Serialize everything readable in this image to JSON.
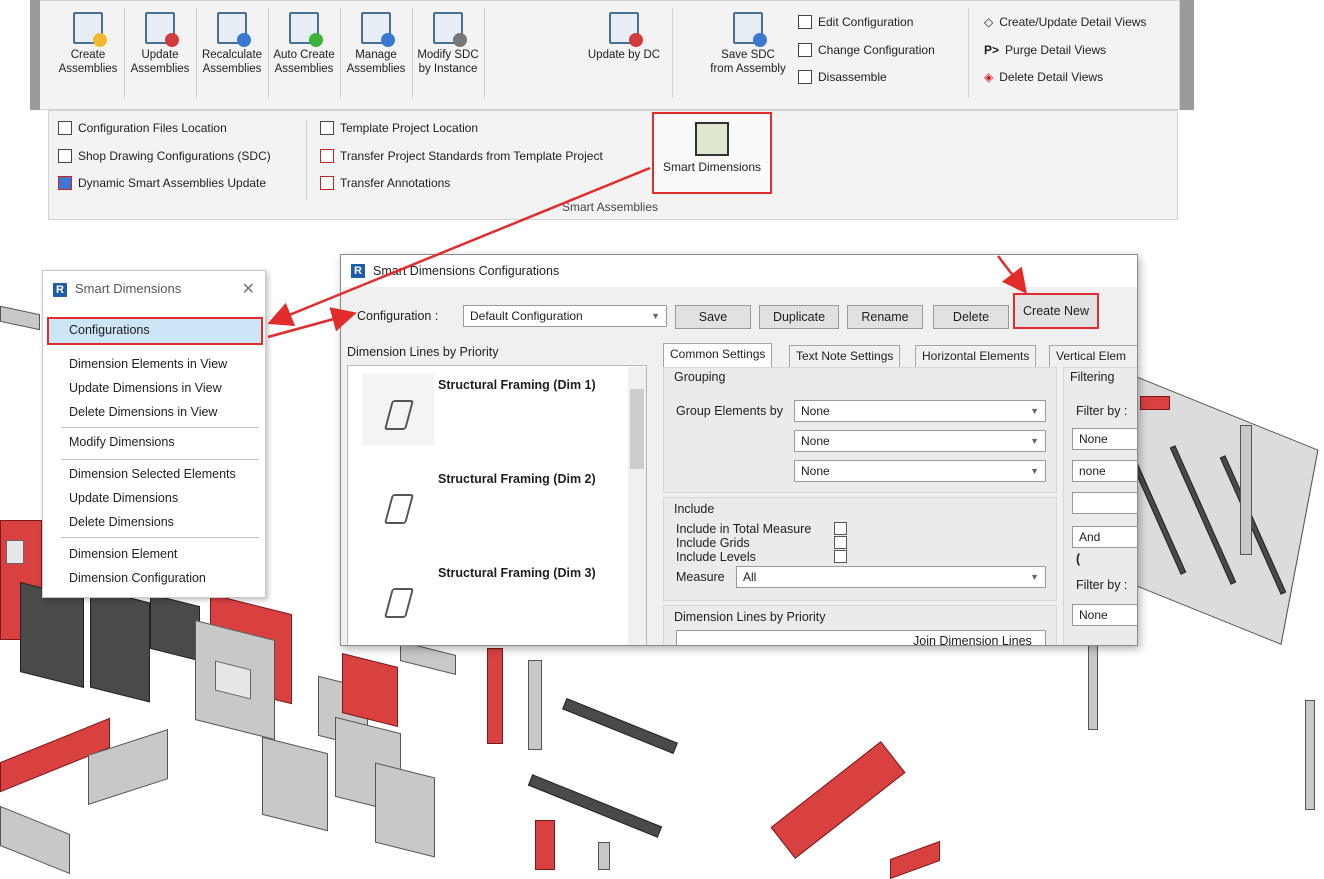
{
  "ribbon": {
    "large_buttons": [
      {
        "label1": "Create",
        "label2": "Assemblies",
        "badge": "#f1b92e"
      },
      {
        "label1": "Update",
        "label2": "Assemblies",
        "badge": "#d23c3c"
      },
      {
        "label1": "Recalculate",
        "label2": "Assemblies",
        "badge": "#3c78d2"
      },
      {
        "label1": "Auto Create",
        "label2": "Assemblies",
        "badge": "#3cb43c"
      },
      {
        "label1": "Manage",
        "label2": "Assemblies",
        "badge": "#3c78d2"
      },
      {
        "label1": "Modify SDC",
        "label2": "by Instance",
        "badge": "#777777"
      },
      {
        "label1": "Update by DC",
        "label2": "",
        "badge": "#d23c3c"
      },
      {
        "label1": "Save SDC",
        "label2": "from Assembly",
        "badge": "#3c78d2"
      }
    ],
    "config_items": [
      "Edit Configuration",
      "Change Configuration",
      "Disassemble"
    ],
    "detail_items": [
      "Create/Update Detail Views",
      "Purge Detail Views",
      "Delete Detail Views"
    ],
    "row2_left": [
      "Configuration Files Location",
      "Shop Drawing Configurations (SDC)",
      "Dynamic Smart Assemblies Update"
    ],
    "row2_mid": [
      "Template Project Location",
      "Transfer Project Standards from Template Project",
      "Transfer Annotations"
    ],
    "smart_dimensions_label": "Smart Dimensions",
    "panel_title": "Smart Assemblies"
  },
  "menu": {
    "logo": "R",
    "title": "Smart Dimensions",
    "close": "✕",
    "items": [
      "Configurations",
      "Dimension Elements in View",
      "Update Dimensions in View",
      "Delete Dimensions in View",
      "Modify Dimensions",
      "Dimension Selected Elements",
      "Update Dimensions",
      "Delete Dimensions",
      "Dimension Element",
      "Dimension Configuration"
    ]
  },
  "dialog": {
    "logo": "R",
    "title": "Smart Dimensions Configurations",
    "config_label": "Configuration :",
    "config_value": "Default Configuration",
    "buttons": [
      "Save",
      "Duplicate",
      "Rename",
      "Delete",
      "Create New"
    ],
    "list_title": "Dimension Lines by Priority",
    "list_items": [
      "Structural Framing (Dim 1)",
      "Structural Framing (Dim 2)",
      "Structural Framing (Dim 3)"
    ],
    "tabs": [
      "Common Settings",
      "Text Note Settings",
      "Horizontal Elements",
      "Vertical Elem"
    ],
    "grouping": {
      "title": "Grouping",
      "group_by_label": "Group Elements by",
      "values": [
        "None",
        "None",
        "None"
      ]
    },
    "include": {
      "title": "Include",
      "items": [
        "Include in Total Measure",
        "Include Grids",
        "Include Levels"
      ],
      "measure_label": "Measure",
      "measure_value": "All"
    },
    "dim_lines_title": "Dimension Lines by Priority",
    "join_label": "Join Dimension Lines",
    "filtering": {
      "title": "Filtering",
      "filter_by": "Filter by :",
      "v1": "None",
      "v2": "none",
      "and": "And",
      "paren": "(",
      "filter_by2": "Filter by :",
      "v3": "None"
    }
  }
}
